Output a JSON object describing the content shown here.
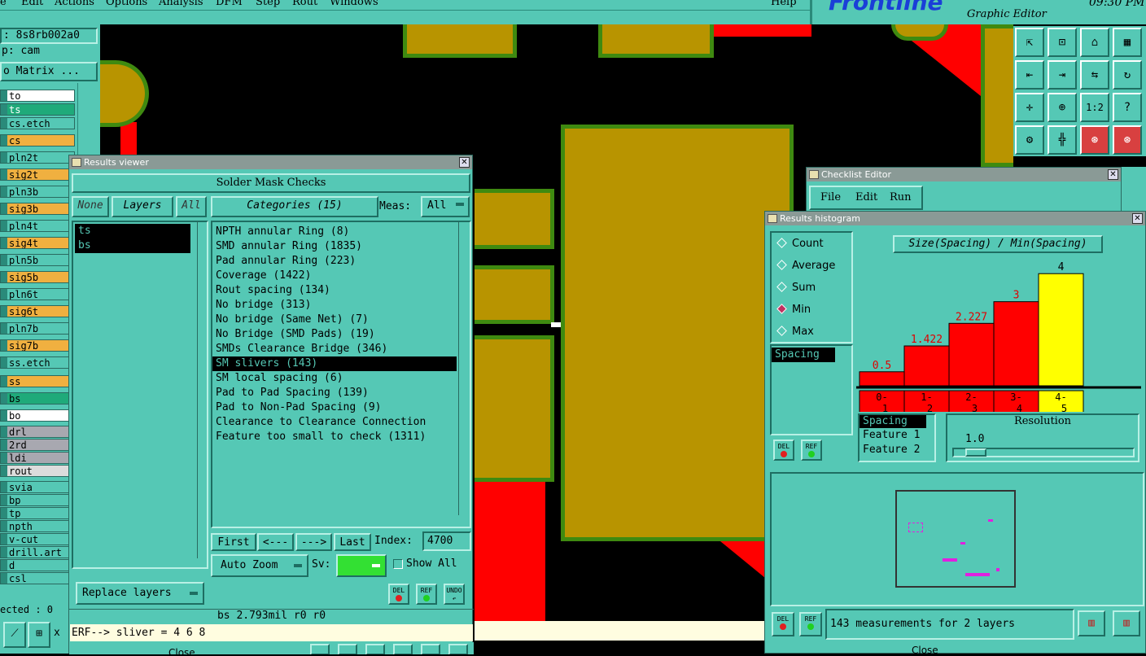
{
  "menubar": {
    "items": [
      "e",
      "Edit",
      "Actions",
      "Options",
      "Analysis",
      "DFM",
      "Step",
      "Rout",
      "Windows"
    ],
    "help": "Help"
  },
  "brand": {
    "logo": "Frontline",
    "subtitle": "Graphic Editor",
    "time": "09:30 PM"
  },
  "left_panel": {
    "job": ": 8s8rb002a0",
    "step": "p: cam",
    "matrix_button": "o Matrix ...",
    "layers": [
      "to",
      "ts",
      "cs.etch",
      "cs",
      "pln2t",
      "sig2t",
      "pln3b",
      "sig3b",
      "pln4t",
      "sig4t",
      "pln5b",
      "sig5b",
      "pln6t",
      "sig6t",
      "pln7b",
      "sig7b",
      "ss.etch",
      "ss",
      "bs",
      "bo",
      "drl",
      "2rd",
      "ldi",
      "rout",
      "svia",
      "bp",
      "tp",
      "npth",
      "v-cut",
      "drill.art",
      "d",
      "csl"
    ],
    "selected_count": "ected : 0",
    "cursor_x": "x"
  },
  "results_viewer": {
    "title": "Results viewer",
    "header": "Solder Mask Checks",
    "none_btn": "None",
    "layers_btn": "Layers",
    "all_btn": "All",
    "layer_list": [
      "ts",
      "bs"
    ],
    "categories_label": "Categories (15)",
    "meas_label": "Meas:",
    "meas_value": "All",
    "categories": [
      "NPTH annular Ring (8)",
      "SMD annular Ring (1835)",
      "Pad annular Ring (223)",
      "Coverage (1422)",
      "Rout spacing (134)",
      "No bridge (313)",
      "No bridge (Same Net) (7)",
      "No Bridge (SMD Pads) (19)",
      "SMDs Clearance Bridge (346)",
      "SM slivers (143)",
      "SM local spacing (6)",
      "Pad to Pad Spacing (139)",
      "Pad to Non-Pad Spacing (9)",
      "Clearance to Clearance Connection",
      "Feature too small to check (1311)"
    ],
    "selected_category": "SM slivers (143)",
    "first": "First",
    "prev": "<---",
    "next": "--->",
    "last": "Last",
    "index_label": "Index:",
    "index_value": "4700",
    "auto_zoom": "Auto Zoom",
    "sv_label": "Sv:",
    "show_all": "Show All",
    "replace_layers": "Replace layers",
    "del": "DEL",
    "ref": "REF",
    "undo": "UNDO",
    "status": "bs 2.793mil  r0  r0",
    "erf": "ERF--> sliver = 4 6 8",
    "close": "Close"
  },
  "checklist_editor": {
    "title": "Checklist Editor",
    "menu": [
      "File",
      "Edit",
      "Run"
    ]
  },
  "histogram": {
    "title": "Results histogram",
    "radios": [
      "Count",
      "Average",
      "Sum",
      "Min",
      "Max"
    ],
    "selected_radio": "Min",
    "list_item": "Spacing",
    "del": "DEL",
    "ref": "REF",
    "props": [
      "Spacing",
      "Feature 1",
      "Feature 2"
    ],
    "resolution_label": "Resolution",
    "resolution_value": "1.0",
    "summary": "143 measurements for 2 layers",
    "close": "Close",
    "colors": {
      "red": "#ff0000",
      "yellow": "#ffff00"
    }
  },
  "chart_data": {
    "type": "bar",
    "title": "Size(Spacing) / Min(Spacing)",
    "categories": [
      "0-1",
      "1-2",
      "2-3",
      "3-4",
      "4-5"
    ],
    "values": [
      0.5,
      1.422,
      2.227,
      3,
      4
    ],
    "value_labels": [
      "0.5",
      "1.422",
      "2.227",
      "3",
      "4"
    ],
    "highlighted": "4-5",
    "ylim": [
      0,
      4.5
    ]
  }
}
